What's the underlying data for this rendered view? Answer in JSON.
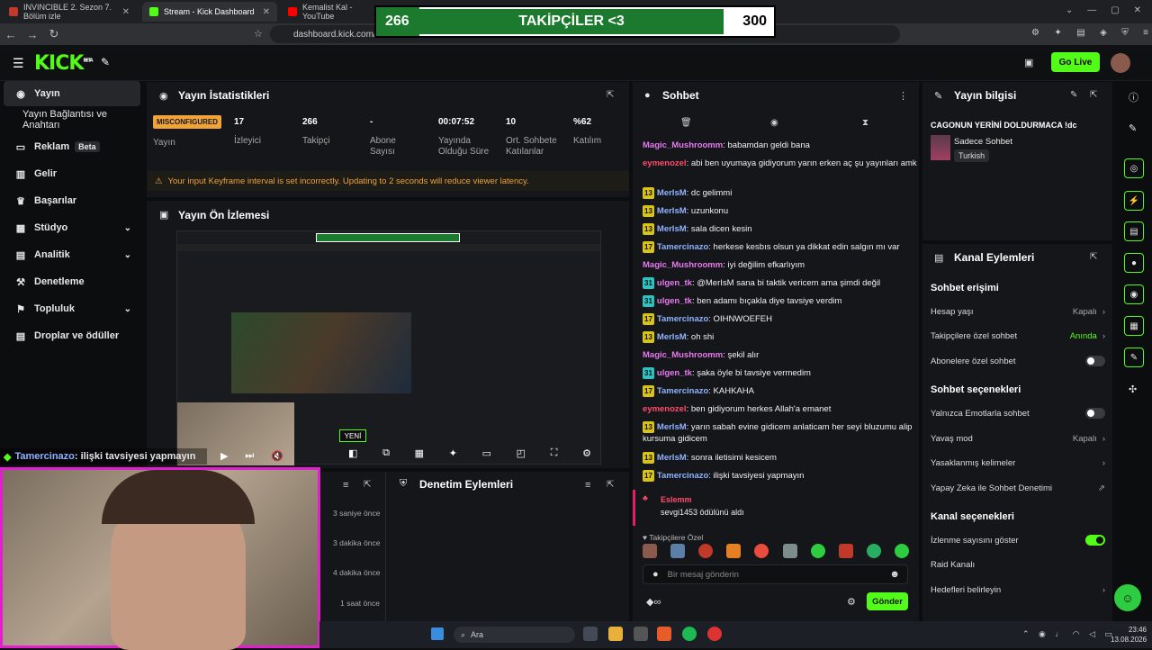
{
  "browser": {
    "tabs": [
      {
        "title": "INVINCIBLE 2. Sezon 7. Bölüm izle"
      },
      {
        "title": "Stream - Kick Dashboard"
      },
      {
        "title": "Kemalist Kal - YouTube"
      }
    ],
    "url": "dashboard.kick.com/st"
  },
  "overlay": {
    "current": "266",
    "label": "TAKİPÇİLER <3",
    "goal": "300",
    "progress": 0.887
  },
  "header": {
    "logo": "KICK",
    "beta": "BETA",
    "go_live": "Go Live"
  },
  "sidebar": {
    "items": [
      {
        "label": "Yayın",
        "icon": "broadcast-icon"
      },
      {
        "label": "Yayın Bağlantısı ve Anahtarı"
      },
      {
        "label": "Reklam",
        "badge": "Beta",
        "icon": "ad-icon"
      },
      {
        "label": "Gelir",
        "icon": "revenue-icon"
      },
      {
        "label": "Başarılar",
        "icon": "trophy-icon"
      },
      {
        "label": "Stüdyo",
        "icon": "studio-icon"
      },
      {
        "label": "Analitik",
        "icon": "analytics-icon"
      },
      {
        "label": "Denetleme",
        "icon": "moderation-icon"
      },
      {
        "label": "Topluluk",
        "icon": "community-icon"
      },
      {
        "label": "Droplar ve ödüller",
        "icon": "drops-icon"
      }
    ]
  },
  "stats": {
    "title": "Yayın İstatistikleri",
    "status_badge": "MISCONFIGURED",
    "items": [
      {
        "value": "17",
        "label": "İzleyici"
      },
      {
        "value": "266",
        "label": "Takipçi"
      },
      {
        "value": "-",
        "label": "Abone Sayısı"
      },
      {
        "value": "00:07:52",
        "label": "Yayında Olduğu Süre"
      },
      {
        "value": "10",
        "label": "Ort. Sohbete Katılanlar"
      },
      {
        "value": "%62",
        "label": "Katılım"
      }
    ],
    "status_label": "Yayın",
    "warning": "Your input Keyframe interval is set incorrectly. Updating to 2 seconds will reduce viewer latency."
  },
  "preview": {
    "title": "Yayın Ön İzlemesi",
    "new_badge": "YENİ"
  },
  "webcam_caption": {
    "user": "Tamercinazo",
    "text": ": ilişki tavsiyesi yapmayın"
  },
  "moderation": {
    "title": "Denetim Eylemleri",
    "times": [
      "3 saniye önce",
      "3 dakika önce",
      "4 dakika önce",
      "1 saat önce"
    ]
  },
  "chat": {
    "title": "Sohbet",
    "messages": [
      {
        "user": "Magic_Mushroomm",
        "color": "#e879f0",
        "badge": "",
        "text": ": babamdan geldi bana"
      },
      {
        "user": "eymenozel",
        "color": "#ff4d6d",
        "badge": "",
        "text": ": abi ben uyumaya gidiyorum yarın erken aç şu yayınları amk"
      },
      {
        "user": "MerIsM",
        "color": "#8fb2ff",
        "badge": "13",
        "text": ": dc gelimmi"
      },
      {
        "user": "MerIsM",
        "color": "#8fb2ff",
        "badge": "13",
        "text": ": uzunkonu"
      },
      {
        "user": "MerIsM",
        "color": "#8fb2ff",
        "badge": "13",
        "text": ": sala dicen kesin"
      },
      {
        "user": "Tamercinazo",
        "color": "#8fb2ff",
        "badge": "17",
        "text": ": herkese kesbıs olsun ya dikkat edin salgın mı var"
      },
      {
        "user": "Magic_Mushroomm",
        "color": "#e879f0",
        "badge": "",
        "text": ": iyi değilim efkarlıyım"
      },
      {
        "user": "ulgen_tk",
        "color": "#e879f0",
        "badge": "31",
        "text": ": @MerIsM sana bi taktik vericem ama şimdi değil"
      },
      {
        "user": "ulgen_tk",
        "color": "#e879f0",
        "badge": "31",
        "text": ": ben adamı bıçakla diye tavsiye verdim"
      },
      {
        "user": "Tamercinazo",
        "color": "#8fb2ff",
        "badge": "17",
        "text": ": OIHNWOEFEH"
      },
      {
        "user": "MerIsM",
        "color": "#8fb2ff",
        "badge": "13",
        "text": ": oh shi"
      },
      {
        "user": "Magic_Mushroomm",
        "color": "#e879f0",
        "badge": "",
        "text": ": şekil alır"
      },
      {
        "user": "ulgen_tk",
        "color": "#e879f0",
        "badge": "31",
        "text": ": şaka öyle bi tavsiye vermedim"
      },
      {
        "user": "Tamercinazo",
        "color": "#8fb2ff",
        "badge": "17",
        "text": ": KAHKAHA"
      },
      {
        "user": "eymenozel",
        "color": "#ff4d6d",
        "badge": "",
        "text": ": ben gidiyorum herkes Allah'a emanet"
      },
      {
        "user": "MerIsM",
        "color": "#8fb2ff",
        "badge": "13",
        "text": ": yarın sabah evine gidicem anlaticam her seyi bluzumu alip kursuma gidicem"
      },
      {
        "user": "MerIsM",
        "color": "#8fb2ff",
        "badge": "13",
        "text": ": sonra iletisimi kesicem"
      },
      {
        "user": "Tamercinazo",
        "color": "#8fb2ff",
        "badge": "17",
        "text": ": ilişki tavsiyesi yapmayın"
      }
    ],
    "reward": {
      "user": "Eslemm",
      "text": "sevgi1453 ödülünü aldı"
    },
    "followers_only": "Takipçilere Özel",
    "placeholder": "Bir mesaj gönderin",
    "send": "Gönder"
  },
  "info": {
    "title": "Yayın bilgisi",
    "stream_title": "CAGONUN YERİNİ DOLDURMACA !dc",
    "category": "Sadece Sohbet",
    "language": "Turkish"
  },
  "channel": {
    "title": "Kanal Eylemleri",
    "chat_access": "Sohbet erişimi",
    "rows1": [
      {
        "label": "Hesap yaşı",
        "value": "Kapalı"
      },
      {
        "label": "Takipçilere özel sohbet",
        "value": "Anında"
      },
      {
        "label": "Abonelere özel sohbet",
        "toggle": false
      }
    ],
    "chat_options": "Sohbet seçenekleri",
    "rows2": [
      {
        "label": "Yalnızca Emotlarla sohbet",
        "toggle": false
      },
      {
        "label": "Yavaş mod",
        "value": "Kapalı"
      },
      {
        "label": "Yasaklanmış kelimeler",
        "value": ""
      },
      {
        "label": "Yapay Zeka ile Sohbet Denetimi",
        "value": ""
      }
    ],
    "channel_options": "Kanal seçenekleri",
    "rows3": [
      {
        "label": "İzlenme sayısını göster",
        "toggle": true
      },
      {
        "label": "Raid Kanalı",
        "value": ""
      },
      {
        "label": "Hedefleri belirleyin",
        "value": ""
      }
    ]
  },
  "taskbar": {
    "search": "Ara",
    "time": "23:46",
    "date": "13.08.2026"
  },
  "colors": {
    "accent": "#53fc18",
    "warning": "#f0a33a",
    "webcam_border": "#e41dd0"
  }
}
